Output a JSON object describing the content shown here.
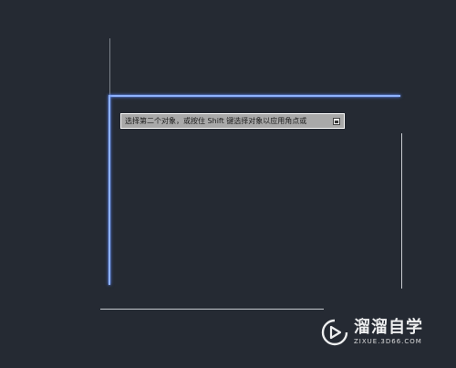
{
  "viewport": {
    "background_color": "#252a33",
    "selected_color": "#8fb2ff",
    "line_color": "#c9ccd1"
  },
  "tooltip": {
    "text": "选择第二个对象，或按住 Shift 键选择对象以应用角点或",
    "icon": "keyboard-toggle-icon"
  },
  "watermark": {
    "title": "溜溜自学",
    "url": "ZIXUE.3D66.COM",
    "logo_icon": "play-logo-icon"
  }
}
